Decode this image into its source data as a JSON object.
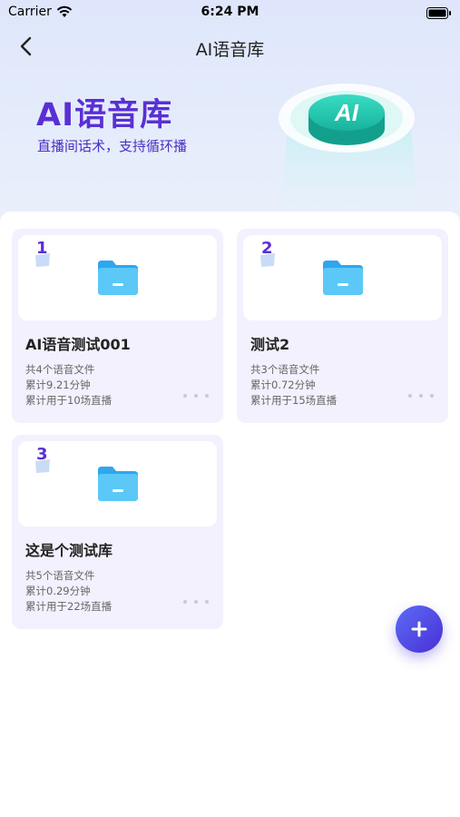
{
  "status_bar": {
    "carrier": "Carrier",
    "time": "6:24 PM"
  },
  "nav": {
    "title": "AI语音库"
  },
  "hero": {
    "title": "AI语音库",
    "subtitle": "直播间话术，支持循环播",
    "badge_text": "AI"
  },
  "libraries": [
    {
      "number": "1",
      "title": "AI语音测试001",
      "file_count": "共4个语音文件",
      "duration": "累计9.21分钟",
      "usage": "累计用于10场直播"
    },
    {
      "number": "2",
      "title": "测试2",
      "file_count": "共3个语音文件",
      "duration": "累计0.72分钟",
      "usage": "累计用于15场直播"
    },
    {
      "number": "3",
      "title": "这是个测试库",
      "file_count": "共5个语音文件",
      "duration": "累计0.29分钟",
      "usage": "累计用于22场直播"
    }
  ],
  "colors": {
    "accent": "#5a2fd6",
    "card_bg": "#f2f1fd",
    "folder": "#3ab4f2",
    "badge": "#2fd0b8"
  },
  "icons": {
    "back": "chevron-left-icon",
    "folder": "folder-icon",
    "more": "more-dots-icon",
    "add": "plus-icon"
  }
}
